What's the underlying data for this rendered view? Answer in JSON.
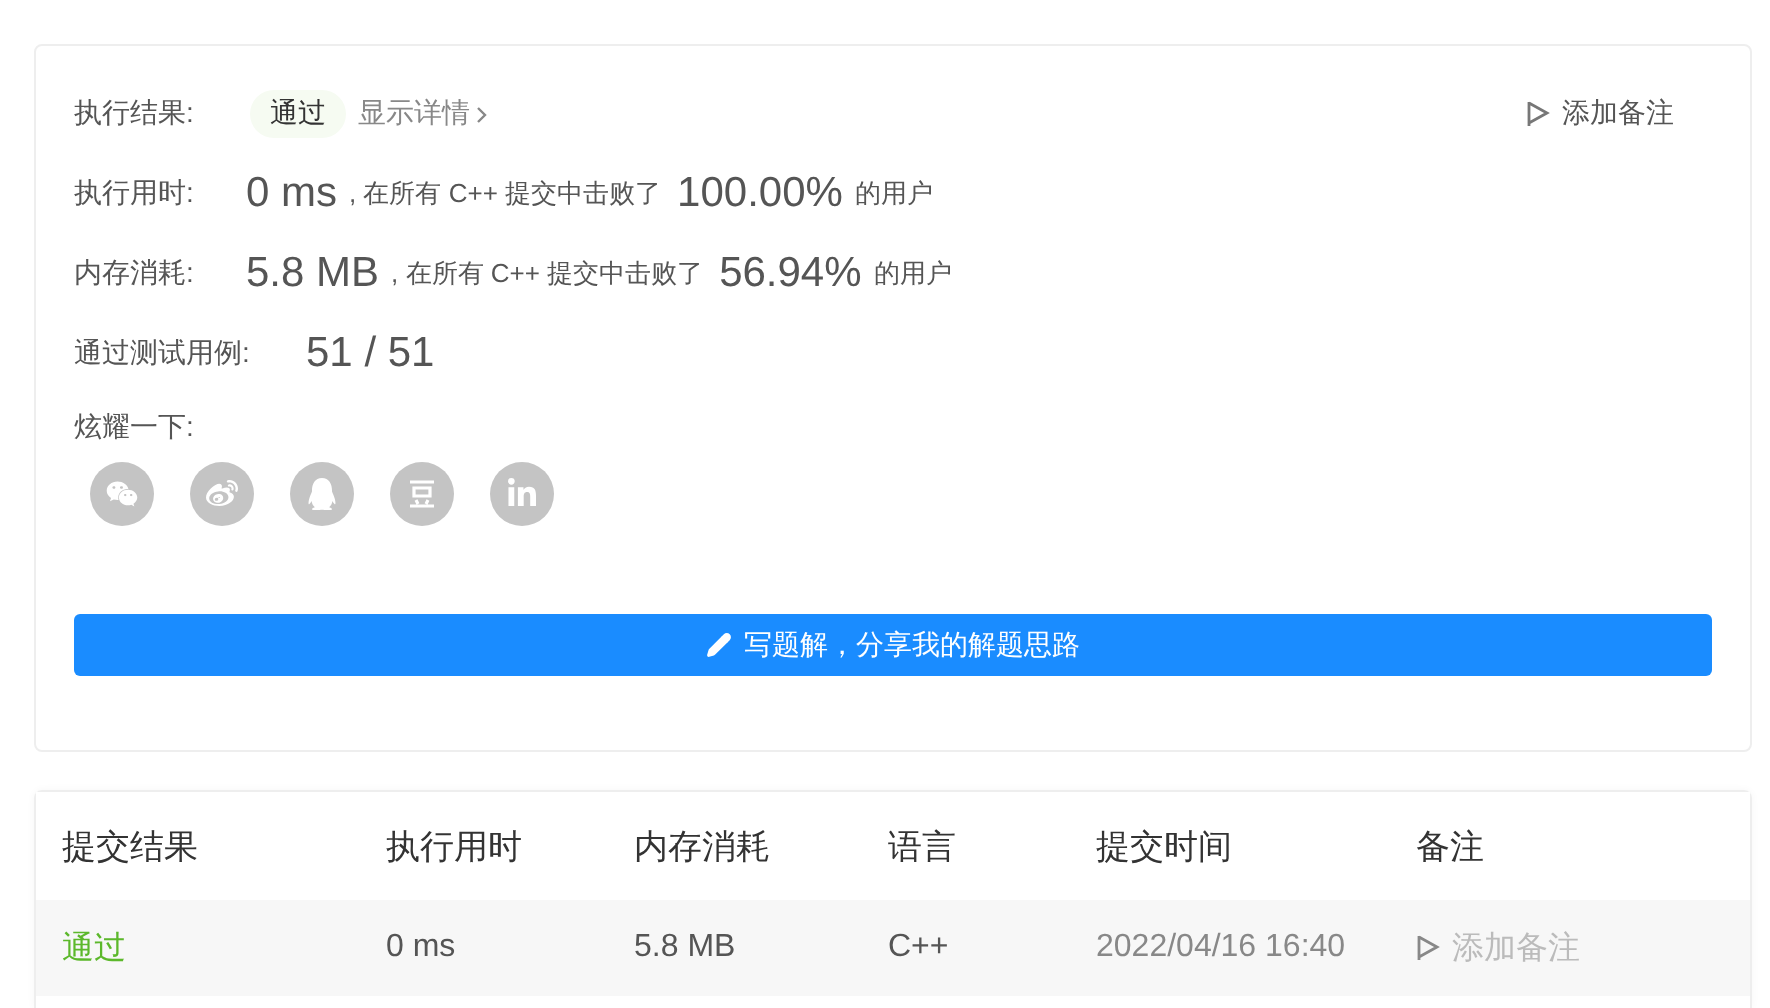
{
  "result": {
    "label": "执行结果:",
    "status": "通过",
    "details_link": "显示详情",
    "add_note": "添加备注"
  },
  "stats": [
    {
      "label": "执行用时:",
      "value": "0 ms",
      "middle": ", 在所有 C++ 提交中击败了",
      "percent": "100.00%",
      "suffix": "的用户"
    },
    {
      "label": "内存消耗:",
      "value": "5.8 MB",
      "middle": ", 在所有 C++ 提交中击败了",
      "percent": "56.94%",
      "suffix": "的用户"
    }
  ],
  "tests": {
    "label": "通过测试用例:",
    "value": "51 / 51"
  },
  "share": {
    "label": "炫耀一下:",
    "icons": [
      {
        "kind": "wechat"
      },
      {
        "kind": "weibo"
      },
      {
        "kind": "qq"
      },
      {
        "kind": "douban"
      },
      {
        "kind": "linkedin"
      }
    ]
  },
  "write_button": "写题解，分享我的解题思路",
  "table": {
    "columns": [
      "提交结果",
      "执行用时",
      "内存消耗",
      "语言",
      "提交时间",
      "备注"
    ],
    "rows": [
      {
        "status": "通过",
        "kind": "pass",
        "time": "0 ms",
        "memory": "5.8 MB",
        "language": "C++",
        "submitted": "2022/04/16 16:40",
        "note": "添加备注"
      }
    ]
  }
}
